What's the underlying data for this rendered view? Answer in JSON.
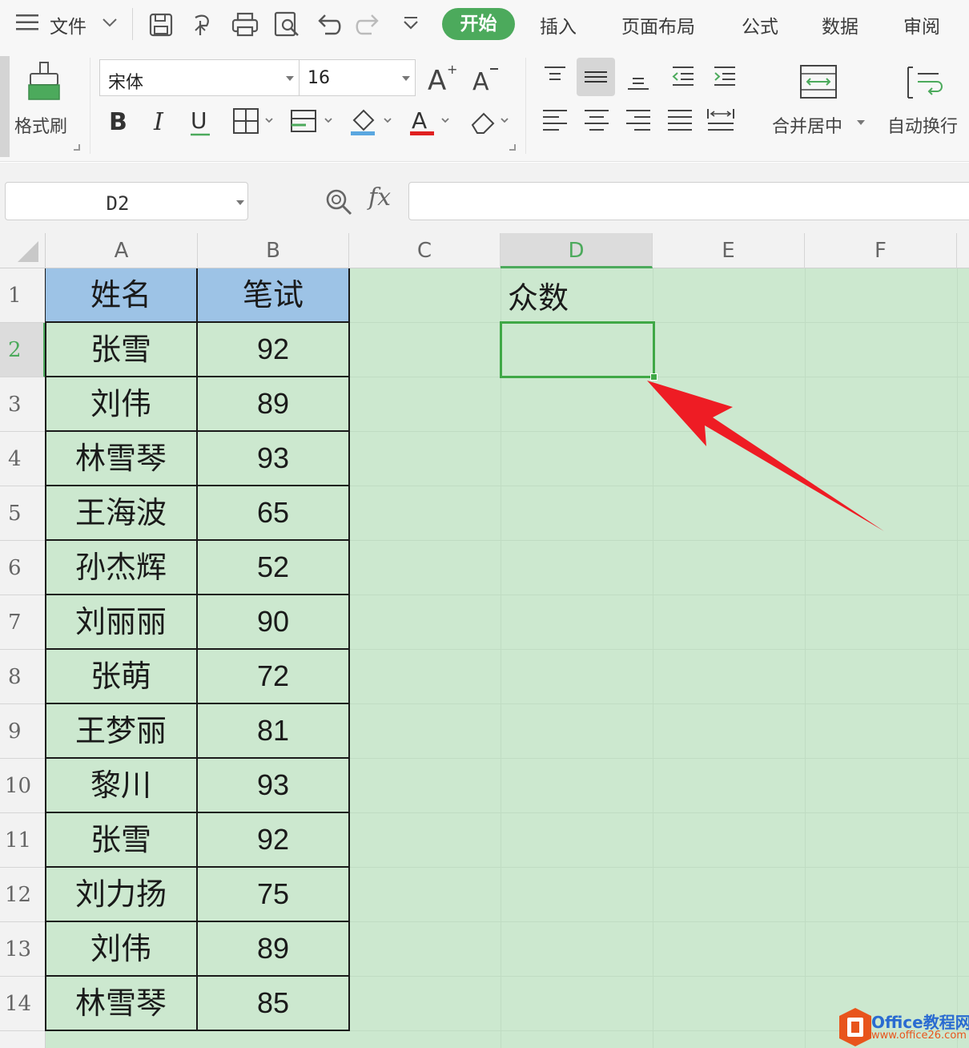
{
  "menu": {
    "file_label": "文件",
    "tabs": [
      "开始",
      "插入",
      "页面布局",
      "公式",
      "数据",
      "审阅"
    ]
  },
  "ribbon": {
    "format_painter_label": "格式刷",
    "font_name": "宋体",
    "font_size": "16",
    "merge_label": "合并居中",
    "wrap_label": "自动换行"
  },
  "formula_bar": {
    "name_box": "D2",
    "fx_label": "fx",
    "formula": ""
  },
  "sheet": {
    "columns": [
      "A",
      "B",
      "C",
      "D",
      "E",
      "F"
    ],
    "selected_column": "D",
    "rows": [
      "1",
      "2",
      "3",
      "4",
      "5",
      "6",
      "7",
      "8",
      "9",
      "10",
      "11",
      "12",
      "13",
      "14"
    ],
    "selected_row": "2",
    "table_headers": [
      "姓名",
      "笔试"
    ],
    "table_rows": [
      [
        "张雪",
        "92"
      ],
      [
        "刘伟",
        "89"
      ],
      [
        "林雪琴",
        "93"
      ],
      [
        "王海波",
        "65"
      ],
      [
        "孙杰辉",
        "52"
      ],
      [
        "刘丽丽",
        "90"
      ],
      [
        "张萌",
        "72"
      ],
      [
        "王梦丽",
        "81"
      ],
      [
        "黎川",
        "93"
      ],
      [
        "张雪",
        "92"
      ],
      [
        "刘力扬",
        "75"
      ],
      [
        "刘伟",
        "89"
      ],
      [
        "林雪琴",
        "85"
      ]
    ],
    "d1_label": "众数",
    "active_cell": "D2"
  },
  "watermark": {
    "brand": "Office教程网",
    "url": "www.office26.com"
  },
  "colors": {
    "accent_green": "#4caa5c",
    "sheet_background": "#cce8cf",
    "header_fill": "#9dc3e6",
    "arrow_red": "#ee1c24"
  }
}
